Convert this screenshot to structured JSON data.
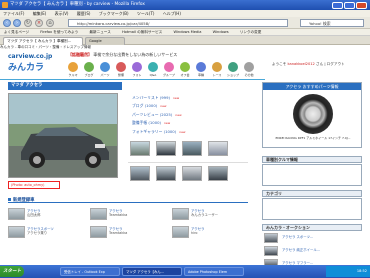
{
  "window": {
    "title": "マツダ アクセラ【 みんカラ 】車種別 - by carview - Mozilla Firefox"
  },
  "menubar": {
    "items": [
      "ファイル(F)",
      "編集(E)",
      "表示(V)",
      "履歴(S)",
      "ブックマーク(B)",
      "ツール(T)",
      "ヘルプ(H)"
    ]
  },
  "navbar": {
    "url": "http://minkara.carview.co.jp/car/4058/",
    "search_placeholder": "Yahoo! 検索"
  },
  "bookmarks": {
    "items": [
      "よく見るページ",
      "Firefox を使ってみよう",
      "最新ニュース",
      "Hotmail の無料サービス",
      "Windows Media",
      "Windows",
      "リンクの変更"
    ]
  },
  "tabs": [
    {
      "label": "マツダ アクセラ【 みんカラ 】車種別..."
    },
    {
      "label": "Google"
    }
  ],
  "site": {
    "top_text": "みんカラ - 車の口コミ・パーツ・整備・ドレスアップ情報",
    "logo_top": "carview.co.jp",
    "logo_main": "みんカラ",
    "banner_prefix": "【話題騒然】",
    "banner_main": "車検で余分な出費をしない為の新しいサービス",
    "nav_items": [
      "クルマ",
      "ブログ",
      "パーツ",
      "整備",
      "フォト",
      "Q&A",
      "グループ",
      "オフ会",
      "車種",
      "レース",
      "ショップ",
      "その他"
    ],
    "login_text": "ようこそ",
    "login_user": "kanakkoel2012",
    "login_suffix": "さん | ログアウト"
  },
  "page": {
    "title": "マツダ アクセラ",
    "photo_credit": "(Photo: auto_ohmy)",
    "menu_links": [
      {
        "label": "メンバーリスト (999)",
        "badge": "new"
      },
      {
        "label": "ブログ (1000)",
        "badge": "new"
      },
      {
        "label": "パーツレビュー (2025)",
        "badge": "new"
      },
      {
        "label": "整備手帳 (1000)",
        "badge": "new"
      },
      {
        "label": "フォトギャラリー (1000)",
        "badge": "new"
      }
    ],
    "new_section_title": "新規登録車",
    "new_cars": [
      {
        "name": "アクセラ",
        "user": "山田太郎"
      },
      {
        "name": "アクセラ",
        "user": "Teamtakka"
      },
      {
        "name": "アクセラ",
        "user": "みんカラユーザー"
      },
      {
        "name": "アクセラスポーツ",
        "user": "アクセラ乗り"
      },
      {
        "name": "アクセラ",
        "user": "Teamtakka"
      },
      {
        "name": "アクセラ",
        "user": "hiro"
      }
    ]
  },
  "sidebar": {
    "ad_title": "アクセラ おすすめパーツ情報",
    "ad_text": "ENKEI RACING RPF1 アルミホイール 17インチ 7.0J...",
    "sections": [
      "車種別クルマ情報",
      "カテゴリ",
      "みんカラ・オークション"
    ],
    "auction_items": [
      "アクセラ スポーツ...",
      "アクセラ 純正ホイール...",
      "アクセラ マフラー..."
    ]
  },
  "taskbar": {
    "start_label": "スタート",
    "tasks": [
      {
        "label": "受信トレイ - Outlook Exp",
        "active": false
      },
      {
        "label": "マツダ アクセラ【みん...",
        "active": true
      },
      {
        "label": "Adobe Photoshop Elem",
        "active": false
      }
    ],
    "clock": "18:52"
  },
  "colors": {
    "accent": "#2a6fc0",
    "new_badge": "#d22222",
    "link": "#2a5fb0"
  }
}
